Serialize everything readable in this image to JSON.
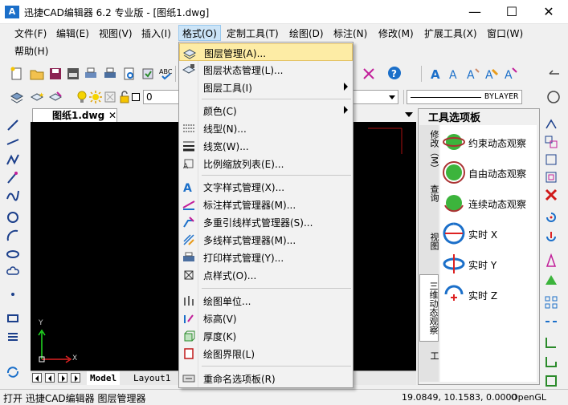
{
  "window": {
    "title": "迅捷CAD编辑器 6.2 专业版 - [图纸1.dwg]",
    "app_icon_text": "A",
    "minimize": "—",
    "maximize": "☐",
    "close": "✕"
  },
  "menubar": {
    "items": [
      "文件(F)",
      "编辑(E)",
      "视图(V)",
      "插入(I)",
      "格式(O)",
      "定制工具(T)",
      "绘图(D)",
      "标注(N)",
      "修改(M)",
      "扩展工具(X)",
      "窗口(W)"
    ],
    "help": "帮助(H)"
  },
  "toolbar": {
    "layer_value": "0",
    "linetype_value": "BYLAYER"
  },
  "document": {
    "tab_label": "图纸1.dwg",
    "tab_close": "✕",
    "layout_tabs": [
      "Model",
      "Layout1"
    ],
    "axis_y": "Y",
    "axis_x": "X"
  },
  "format_menu": {
    "items": [
      {
        "label": "图层管理(A)...",
        "submenu": false
      },
      {
        "label": "图层状态管理(L)...",
        "submenu": false
      },
      {
        "label": "图层工具(I)",
        "submenu": true
      },
      {
        "label": "颜色(C)",
        "submenu": true
      },
      {
        "label": "线型(N)...",
        "submenu": false
      },
      {
        "label": "线宽(W)...",
        "submenu": false
      },
      {
        "label": "比例缩放列表(E)...",
        "submenu": false
      },
      {
        "label": "文字样式管理(X)...",
        "submenu": false
      },
      {
        "label": "标注样式管理器(M)...",
        "submenu": false
      },
      {
        "label": "多重引线样式管理器(S)...",
        "submenu": false
      },
      {
        "label": "多线样式管理器(M)...",
        "submenu": false
      },
      {
        "label": "打印样式管理(Y)...",
        "submenu": false
      },
      {
        "label": "点样式(O)...",
        "submenu": false
      },
      {
        "label": "绘图单位...",
        "submenu": false
      },
      {
        "label": "标高(V)",
        "submenu": false
      },
      {
        "label": "厚度(K)",
        "submenu": false
      },
      {
        "label": "绘图界限(L)",
        "submenu": false
      },
      {
        "label": "重命名选项板(R)",
        "submenu": false
      }
    ]
  },
  "palette": {
    "title": "工具选项板",
    "vtabs": [
      "修改（M）",
      "查询",
      "视图",
      "三维动态观察",
      "工"
    ],
    "items": [
      "约束动态观察",
      "自由动态观察",
      "连续动态观察",
      "实时 X",
      "实时 Y",
      "实时 Z"
    ]
  },
  "status": {
    "message": "打开 迅捷CAD编辑器 图层管理器",
    "coords": "19.0849, 10.1583, 0.0000",
    "renderer": "OpenGL"
  },
  "colors": {
    "menu_highlight": "#fdeca5",
    "active_menu": "#cce4f7",
    "canvas": "#000000",
    "accent_blue": "#1b6fc9"
  }
}
